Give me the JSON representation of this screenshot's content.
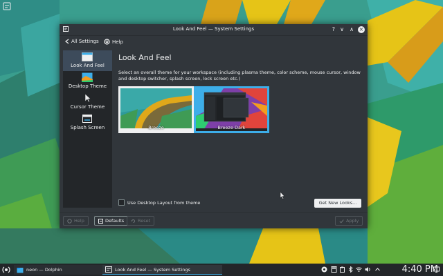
{
  "window": {
    "title": "Look And Feel — System Settings",
    "help_glyph": "?",
    "minimize_glyph": "∨",
    "maximize_glyph": "∧",
    "close_glyph": "×"
  },
  "toolbar": {
    "all_settings_label": "All Settings",
    "help_label": "Help"
  },
  "sidebar": {
    "items": [
      {
        "label": "Look And Feel",
        "icon": "folder-icon",
        "active": true
      },
      {
        "label": "Desktop Theme",
        "icon": "desktop-theme-icon",
        "active": false
      },
      {
        "label": "Cursor Theme",
        "icon": "cursor-icon",
        "active": false
      },
      {
        "label": "Splash Screen",
        "icon": "splash-screen-icon",
        "active": false
      }
    ]
  },
  "content": {
    "heading": "Look And Feel",
    "description": "Select an overall theme for your workspace (including plasma theme, color scheme, mouse cursor, window and desktop switcher, splash screen, lock screen etc.)",
    "themes": [
      {
        "label": "Breeze",
        "selected": false
      },
      {
        "label": "Breeze Dark",
        "selected": true
      }
    ],
    "checkbox_label": "Use Desktop Layout from theme",
    "get_new_label": "Get New Looks..."
  },
  "bottombar": {
    "help_label": "Help",
    "defaults_label": "Defaults",
    "reset_label": "Reset",
    "apply_label": "Apply"
  },
  "taskbar": {
    "tasks": [
      {
        "label": "neon — Dolphin",
        "active": false
      },
      {
        "label": "Look And Feel — System Settings",
        "active": true
      }
    ],
    "clock": "4:40 PM"
  },
  "colors": {
    "accent": "#3daee9",
    "window_bg": "#31363b",
    "sidebar_bg": "#232629",
    "selection_bg": "#3d4b5b"
  }
}
